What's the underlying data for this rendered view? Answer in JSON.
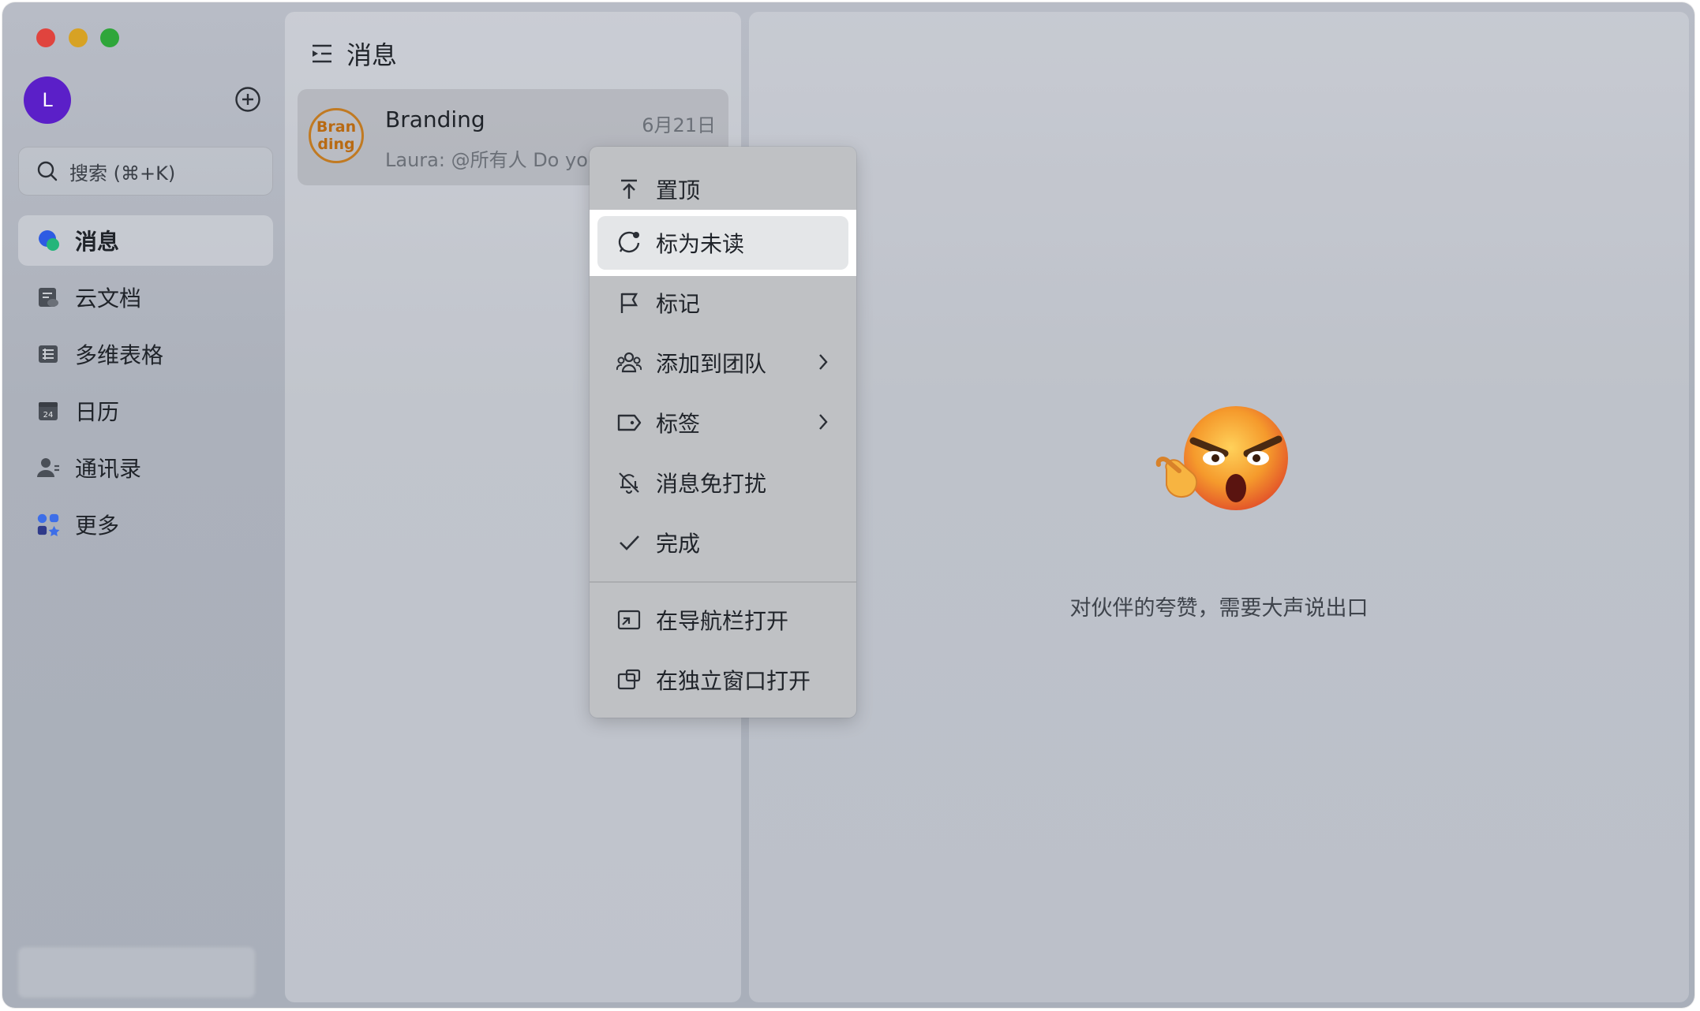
{
  "window": {
    "title": "消息"
  },
  "sidebar": {
    "avatar_initial": "L",
    "search_placeholder": "搜索 (⌘+K)",
    "items": [
      {
        "label": "消息",
        "icon": "message-bubble-icon",
        "active": true
      },
      {
        "label": "云文档",
        "icon": "cloud-doc-icon",
        "active": false
      },
      {
        "label": "多维表格",
        "icon": "table-icon",
        "active": false
      },
      {
        "label": "日历",
        "icon": "calendar-icon",
        "active": false,
        "calendar_day": "24"
      },
      {
        "label": "通讯录",
        "icon": "contacts-icon",
        "active": false
      },
      {
        "label": "更多",
        "icon": "more-apps-icon",
        "active": false
      }
    ]
  },
  "chat_list": {
    "title": "消息",
    "items": [
      {
        "avatar_text_1": "Bran",
        "avatar_text_2": "ding",
        "name": "Branding",
        "date": "6月21日",
        "preview": "Laura: @所有人 Do you"
      }
    ]
  },
  "context_menu": {
    "items": [
      {
        "label": "置顶",
        "icon": "pin-top-icon"
      },
      {
        "label": "标为未读",
        "icon": "mark-unread-icon",
        "highlighted": true
      },
      {
        "label": "标记",
        "icon": "flag-icon"
      },
      {
        "label": "添加到团队",
        "icon": "team-icon",
        "submenu": true
      },
      {
        "label": "标签",
        "icon": "tag-icon",
        "submenu": true
      },
      {
        "label": "消息免打扰",
        "icon": "mute-bell-icon"
      },
      {
        "label": "完成",
        "icon": "check-icon"
      },
      {
        "label": "在导航栏打开",
        "icon": "open-in-nav-icon"
      },
      {
        "label": "在独立窗口打开",
        "icon": "open-window-icon"
      }
    ]
  },
  "detail": {
    "empty_text": "对伙伴的夸赞，需要大声说出口",
    "illustration": "angry-emoji-thumbs-icon"
  },
  "colors": {
    "avatar_bg": "#5b1fc8",
    "branding_ring": "#c17a22",
    "close": "#e0443e",
    "minimize": "#d7a224",
    "zoom": "#2fa63a"
  }
}
